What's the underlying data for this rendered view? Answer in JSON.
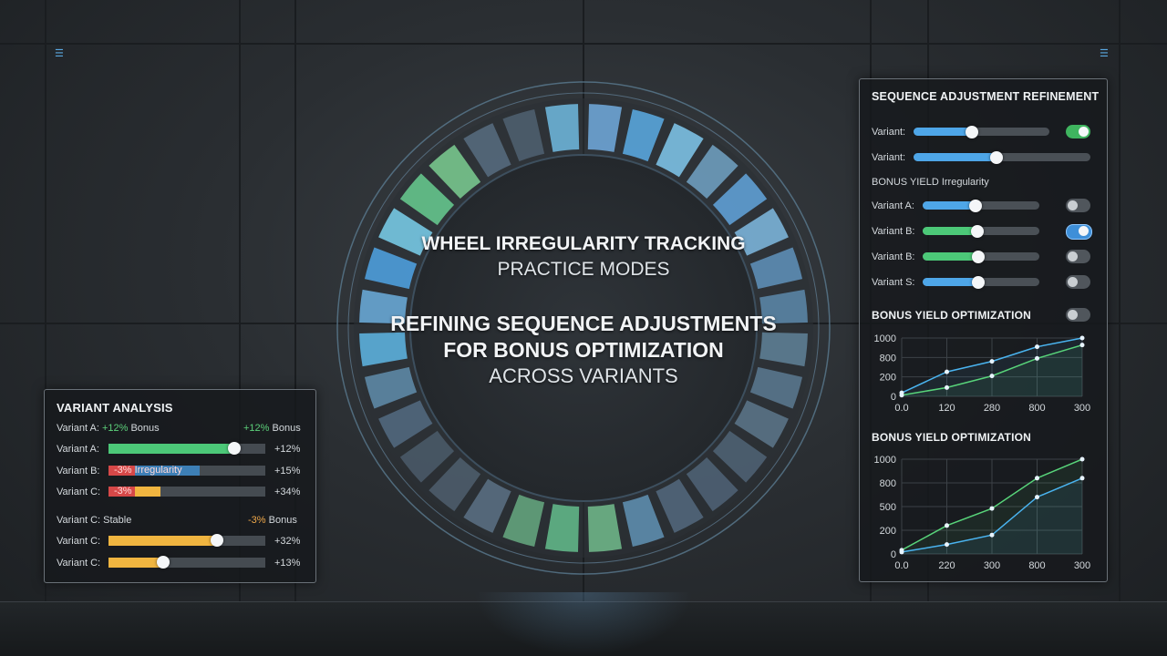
{
  "title": {
    "line1": "WHEEL IRREGULARITY TRACKING",
    "line2": "PRACTICE MODES",
    "line3": "REFINING SEQUENCE ADJUSTMENTS",
    "line4": "FOR BONUS OPTIMIZATION",
    "line5": "ACROSS VARIANTS"
  },
  "wheel": {
    "segments": [
      "#6fa7d9",
      "#5aa8e0",
      "#7ec4e8",
      "#6f9fc0",
      "#61a2d8",
      "#7db6dd",
      "#5f8fb8",
      "#5b86a8",
      "#5f7f96",
      "#5a7890",
      "#5b7489",
      "#4e6274",
      "#4f6275",
      "#52687c",
      "#5f8fb0",
      "#70b88a",
      "#62b98a",
      "#64a67e",
      "#5a6f83",
      "#4d5d6c",
      "#4a5a69",
      "#52697f",
      "#5f8aa8",
      "#5db3e0",
      "#6aaad8",
      "#4fa0e0",
      "#79cce8",
      "#66c88e",
      "#7ac98f",
      "#576b7e",
      "#4f6070",
      "#6eb6dc"
    ],
    "segment_level_colors": {
      "green": "#72c184",
      "blue": "#5aa8e0",
      "slate": "#4f6274"
    }
  },
  "variant_analysis": {
    "title": "VARIANT ANALYSIS",
    "header_label": "Variant A:",
    "header_delta": "+12%",
    "header_suffix": "Bonus",
    "header_right_delta": "+12%",
    "header_right_suffix": "Bonus",
    "rows": [
      {
        "label": "Variant A:",
        "fill_text": "",
        "value": "+12%",
        "level": 0.8,
        "color": "#4cc878"
      },
      {
        "label": "Variant B:",
        "fill_text": "-3%",
        "fill_text2": "Irregularity",
        "value": "+15%",
        "level": 0.58,
        "color": "#d64848",
        "color2": "#3d7fb6"
      },
      {
        "label": "Variant C:",
        "fill_text": "-3%",
        "value": "+34%",
        "level": 0.33,
        "color": "#d64848",
        "color2": "#f0b540"
      }
    ],
    "stable_label": "Variant C: Stable",
    "stable_delta": "-3%",
    "stable_suffix": "Bonus",
    "rows2": [
      {
        "label": "Variant C:",
        "value": "+32%",
        "level": 0.69,
        "color": "#f0b540"
      },
      {
        "label": "Variant C:",
        "value": "+13%",
        "level": 0.35,
        "color": "#f0b540"
      }
    ]
  },
  "refinement": {
    "title": "SEQUENCE ADJUSTMENT REFINEMENT",
    "sliders_top": [
      {
        "label": "Variant:",
        "level": 0.43,
        "color": "#4ea6e8",
        "toggle": "on-green"
      },
      {
        "label": "Variant:",
        "level": 0.47,
        "color": "#4ea6e8",
        "toggle": "none"
      }
    ],
    "bonus_label": "BONUS YIELD Irregularity",
    "sliders_bonus": [
      {
        "label": "Variant A:",
        "level": 0.45,
        "color": "#4ea6e8",
        "toggle": "off"
      },
      {
        "label": "Variant B:",
        "level": 0.47,
        "color": "#4cc878",
        "toggle": "on-blue"
      },
      {
        "label": "Variant B:",
        "level": 0.48,
        "color": "#4cc878",
        "toggle": "off"
      },
      {
        "label": "Variant S:",
        "level": 0.48,
        "color": "#4ea6e8",
        "toggle": "off"
      }
    ],
    "chart1_title": "BONUS YIELD OPTIMIZATION",
    "chart2_title": "BONUS YIELD OPTIMIZATION"
  },
  "chart_data": [
    {
      "type": "line",
      "title": "BONUS YIELD OPTIMIZATION",
      "x_ticks": [
        "0.0",
        "120",
        "280",
        "800",
        "300"
      ],
      "y_ticks": [
        "0",
        "200",
        "800",
        "1000"
      ],
      "series": [
        {
          "color": "#4ab4f0",
          "values": [
            60,
            420,
            600,
            850,
            1000
          ]
        },
        {
          "color": "#58d47a",
          "values": [
            20,
            150,
            350,
            650,
            880
          ]
        }
      ]
    },
    {
      "type": "line",
      "title": "BONUS YIELD OPTIMIZATION",
      "x_ticks": [
        "0.0",
        "220",
        "300",
        "800",
        "300"
      ],
      "y_ticks": [
        "0",
        "200",
        "500",
        "800",
        "1000"
      ],
      "series": [
        {
          "color": "#58d47a",
          "values": [
            40,
            300,
            480,
            800,
            1000
          ]
        },
        {
          "color": "#4ab4f0",
          "values": [
            20,
            100,
            200,
            600,
            800
          ]
        }
      ]
    }
  ]
}
